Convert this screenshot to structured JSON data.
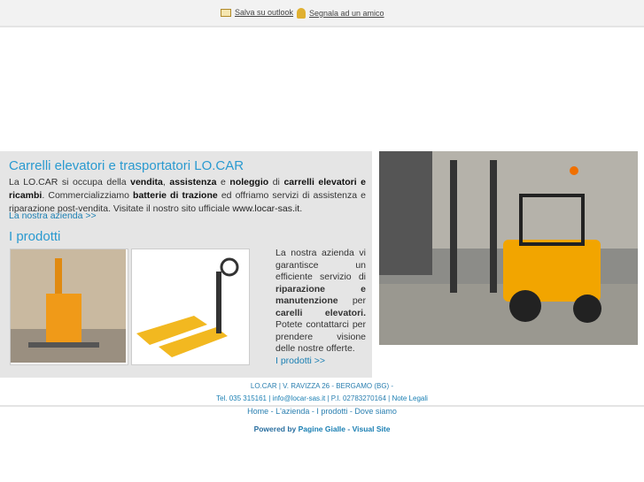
{
  "topbar": {
    "outlook": "Salva su outlook",
    "friend": "Segnala ad un amico"
  },
  "main": {
    "title": "Carrelli elevatori e trasportatori LO.CAR",
    "intro": {
      "p1": "La LO.CAR si occupa della ",
      "b1": "vendita",
      "c1": ", ",
      "b2": "assistenza",
      "p2": " e ",
      "b3": "noleggio",
      "p3": " di ",
      "b4": "carrelli elevatori e ricambi",
      "p4": ". Commercializziamo ",
      "b5": "batterie di trazione",
      "p5": " ed offriamo servizi di assistenza e riparazione post-vendita. Visitate il nostro sito ufficiale ",
      "site": "www.locar-sas.it",
      "p6": "."
    },
    "azienda_link": "La nostra azienda >>",
    "products_title": "I prodotti",
    "side": {
      "t1": "La nostra azienda vi garantisce un efficiente servizio di ",
      "b1": "riparazione e manutenzione",
      "t2": " per ",
      "b2": "carelli elevatori.",
      "t3": " Potete contattarci per prendere visione delle nostre offerte.",
      "link": "I prodotti >>"
    }
  },
  "footer": {
    "address": "LO.CAR | V. RAVIZZA 26 - BERGAMO (BG) -",
    "tel": "Tel. 035 315161 |",
    "email": "info@locar-sas.it",
    "piva": " | P.I. 02783270164 | ",
    "legal": "Note Legali",
    "nav": [
      "Home",
      "L'azienda",
      "I prodotti",
      "Dove siamo"
    ],
    "sep": " - ",
    "powered": "Powered by ",
    "pg": "Pagine Gialle",
    "dash": " - ",
    "vs": "Visual Site"
  }
}
